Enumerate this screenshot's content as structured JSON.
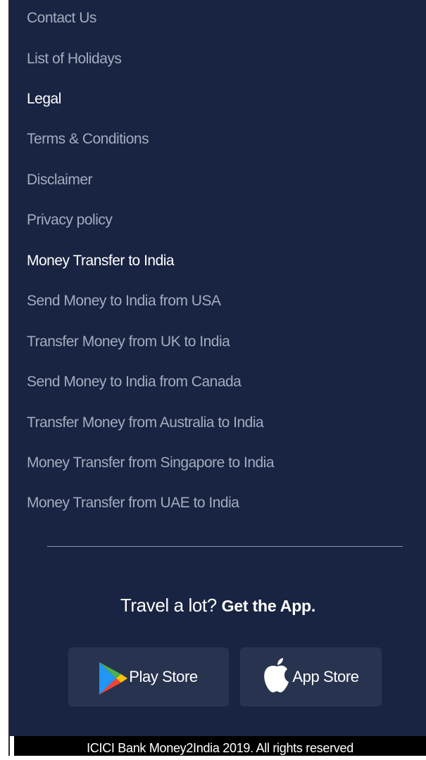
{
  "footer": {
    "links": [
      {
        "label": "Contact Us",
        "kind": "item"
      },
      {
        "label": "List of Holidays",
        "kind": "item"
      },
      {
        "label": "Legal",
        "kind": "heading"
      },
      {
        "label": "Terms & Conditions",
        "kind": "item"
      },
      {
        "label": "Disclaimer",
        "kind": "item"
      },
      {
        "label": "Privacy policy",
        "kind": "item"
      },
      {
        "label": "Money Transfer to India",
        "kind": "heading"
      },
      {
        "label": "Send Money to India from USA",
        "kind": "item"
      },
      {
        "label": "Transfer Money from UK to India",
        "kind": "item"
      },
      {
        "label": "Send Money to India from Canada",
        "kind": "item"
      },
      {
        "label": "Transfer Money from Australia to India",
        "kind": "item"
      },
      {
        "label": "Money Transfer from Singapore to India",
        "kind": "item"
      },
      {
        "label": "Money Transfer from UAE to India",
        "kind": "item"
      }
    ],
    "app_promo": {
      "tagline_normal": "Travel a lot?",
      "tagline_bold": "Get the App."
    },
    "stores": {
      "play_label": "Play Store",
      "apple_label": "App Store"
    },
    "copyright": "ICICI Bank Money2India 2019. All rights reserved"
  },
  "colors": {
    "background": "#192442",
    "link_muted": "#a3acbf",
    "heading": "#ffffff",
    "button_bg": "#28344f",
    "copyright_bar": "#000000"
  }
}
